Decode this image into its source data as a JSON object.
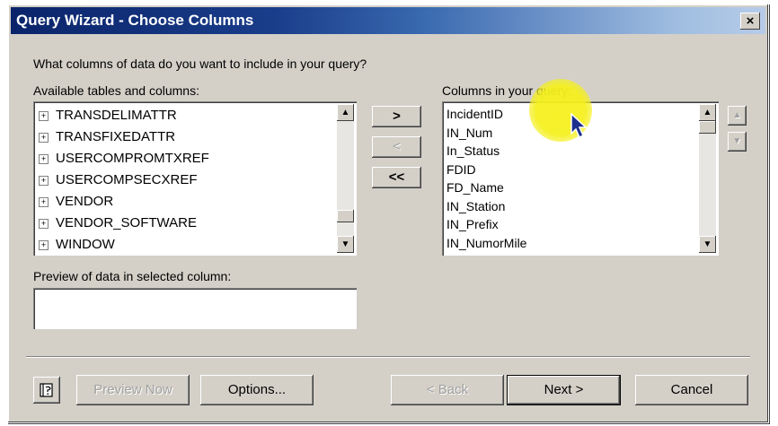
{
  "window": {
    "title": "Query Wizard - Choose Columns",
    "close_glyph": "×"
  },
  "prompt": "What columns of data do you want to include in your query?",
  "available": {
    "label": "Available tables and columns:",
    "items": [
      "TRANSDELIMATTR",
      "TRANSFIXEDATTR",
      "USERCOMPROMTXREF",
      "USERCOMPSECXREF",
      "VENDOR",
      "VENDOR_SOFTWARE",
      "WINDOW"
    ]
  },
  "move_buttons": {
    "add": ">",
    "remove": "<",
    "remove_all": "<<"
  },
  "query": {
    "label": "Columns in your query:",
    "items": [
      "IncidentID",
      "IN_Num",
      "In_Status",
      "FDID",
      "FD_Name",
      "IN_Station",
      "IN_Prefix",
      "IN_NumorMile"
    ]
  },
  "preview": {
    "label": "Preview of data in selected column:",
    "value": ""
  },
  "footer": {
    "preview_now": "Preview Now",
    "options": "Options...",
    "back": "< Back",
    "next": "Next >",
    "cancel": "Cancel"
  },
  "icons": {
    "help": "help-book-icon",
    "scroll_up": "▲",
    "scroll_down": "▼",
    "expand": "+"
  },
  "colors": {
    "title_start": "#0a246a",
    "title_end": "#b7cbe8",
    "face": "#d4d0c8",
    "highlight": "#f5f01e"
  }
}
